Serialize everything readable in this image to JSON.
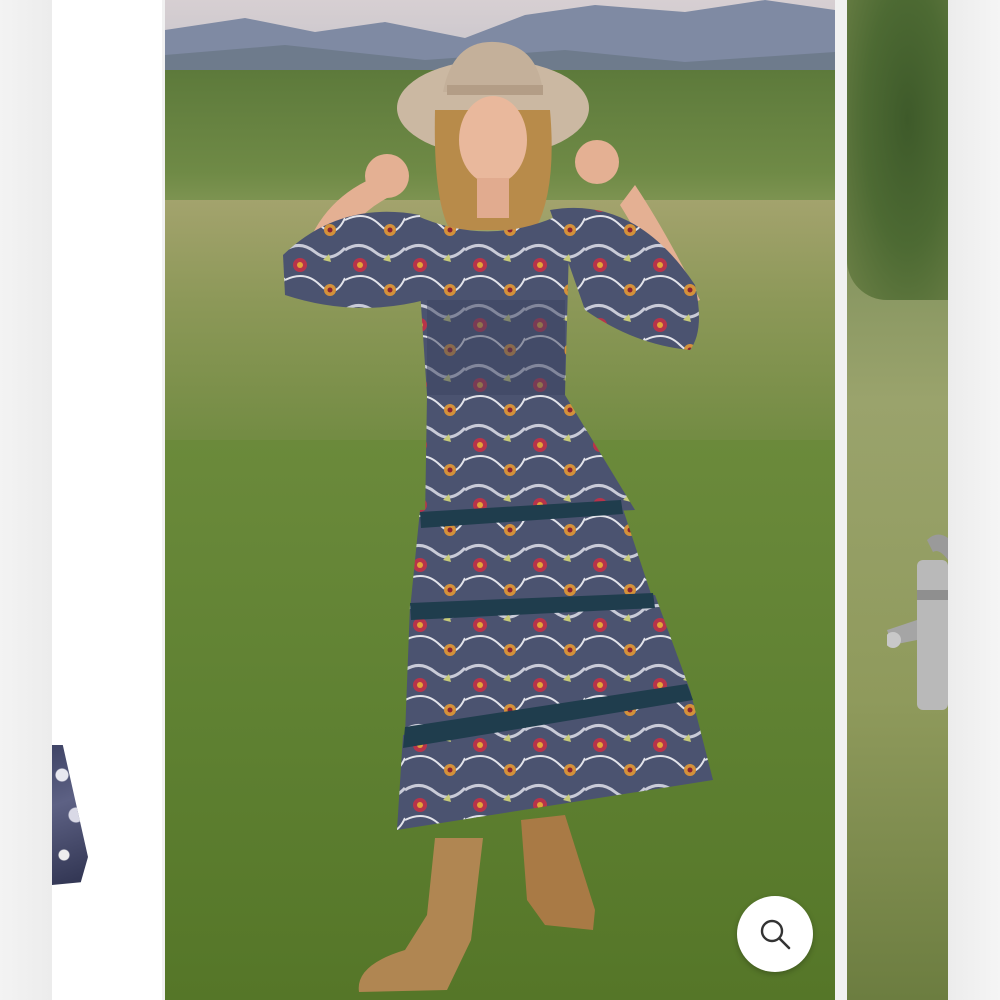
{
  "carousel": {
    "current_index": 1,
    "slides": [
      {
        "subject": "dress-hem-partial"
      },
      {
        "subject": "model-in-floral-tiered-dress"
      },
      {
        "subject": "field-with-watering-can"
      }
    ]
  },
  "controls": {
    "zoom_icon": "search-icon"
  },
  "colors": {
    "background": "#f1f1f1",
    "zoom_button_bg": "#ffffff",
    "icon_stroke": "#333333"
  }
}
